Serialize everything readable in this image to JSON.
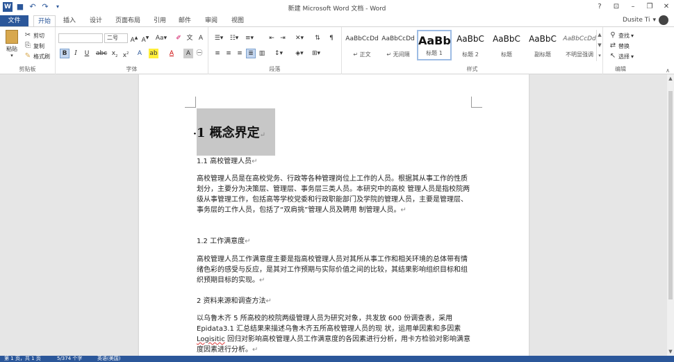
{
  "window": {
    "title": "新建 Microsoft Word 文档 - Word",
    "controls": [
      "?",
      "⊡",
      "–",
      "❐",
      "✕"
    ]
  },
  "tabs": {
    "file": "文件",
    "items": [
      "开始",
      "插入",
      "设计",
      "页面布局",
      "引用",
      "邮件",
      "审阅",
      "视图"
    ],
    "active": "开始"
  },
  "user": {
    "name": "Dusite Ti"
  },
  "ribbon": {
    "clipboard": {
      "paste": "粘贴",
      "cut": "剪切",
      "copy": "复制",
      "format_painter": "格式刷",
      "label": "剪贴板"
    },
    "font": {
      "name_value": "",
      "size_value": "二号",
      "label": "字体"
    },
    "paragraph": {
      "label": "段落"
    },
    "styles": {
      "label": "样式",
      "items": [
        {
          "sample": "AaBbCcDd",
          "name": "↵ 正文"
        },
        {
          "sample": "AaBbCcDd",
          "name": "↵ 无间隔"
        },
        {
          "sample": "AaBb",
          "name": "标题 1"
        },
        {
          "sample": "AaBbC",
          "name": "标题 2"
        },
        {
          "sample": "AaBbC",
          "name": "标题"
        },
        {
          "sample": "AaBbC",
          "name": "副标题"
        },
        {
          "sample": "AaBbCcDd",
          "name": "不明显强调"
        }
      ],
      "selected": "标题 1"
    },
    "editing": {
      "find": "查找",
      "replace": "替换",
      "select": "选择",
      "label": "编辑"
    }
  },
  "document": {
    "heading": "1  概念界定",
    "sec11": "1.1 高校管理人员",
    "para1": "高校管理人员是在高校党务、行政等各种管理岗位上工作的人员。根据其从事工作的性质划分，主要分为决策层、管理层、事务层三类人员。本研究中的高校 管理人员是指校院两级从事管理工作，包括高等学校党委和行政职能部门及学院的管理人员，主要是管理层、事务层的工作人员，包括了“双肩挑”管理人员及聘用 制管理人员。",
    "sec12": "1.2 工作满意度",
    "para2": "高校管理人员工作满意度主要是指高校管理人员对其所从事工作和相关环境的总体带有情绪色彩的感受与反应，是其对工作预期与实际价值之间的比较，其结果影响组织目标和组织预期目标的实现。",
    "sec2": "2 资料来源和调查方法",
    "para3_a": "以乌鲁木齐 5 所高校的校院两级管理人员为研究对象，共发放 600 份调查表，采用 Epidata3.1 汇总结果来描述乌鲁木齐五所高校管理人员的现 状，运用单因素和多因素 ",
    "para3_b": "Logisitic",
    "para3_c": " 回归对影响高校管理人员工作满意度的各因素进行分析，用卡方检验对影响满意度因素进行分析。"
  },
  "status": {
    "page": "第 1 页，共 1 页",
    "words": "5/374 个字",
    "lang": "英语(美国)"
  },
  "colors": {
    "accent": "#2b579a",
    "selection": "#c7c7c7"
  }
}
